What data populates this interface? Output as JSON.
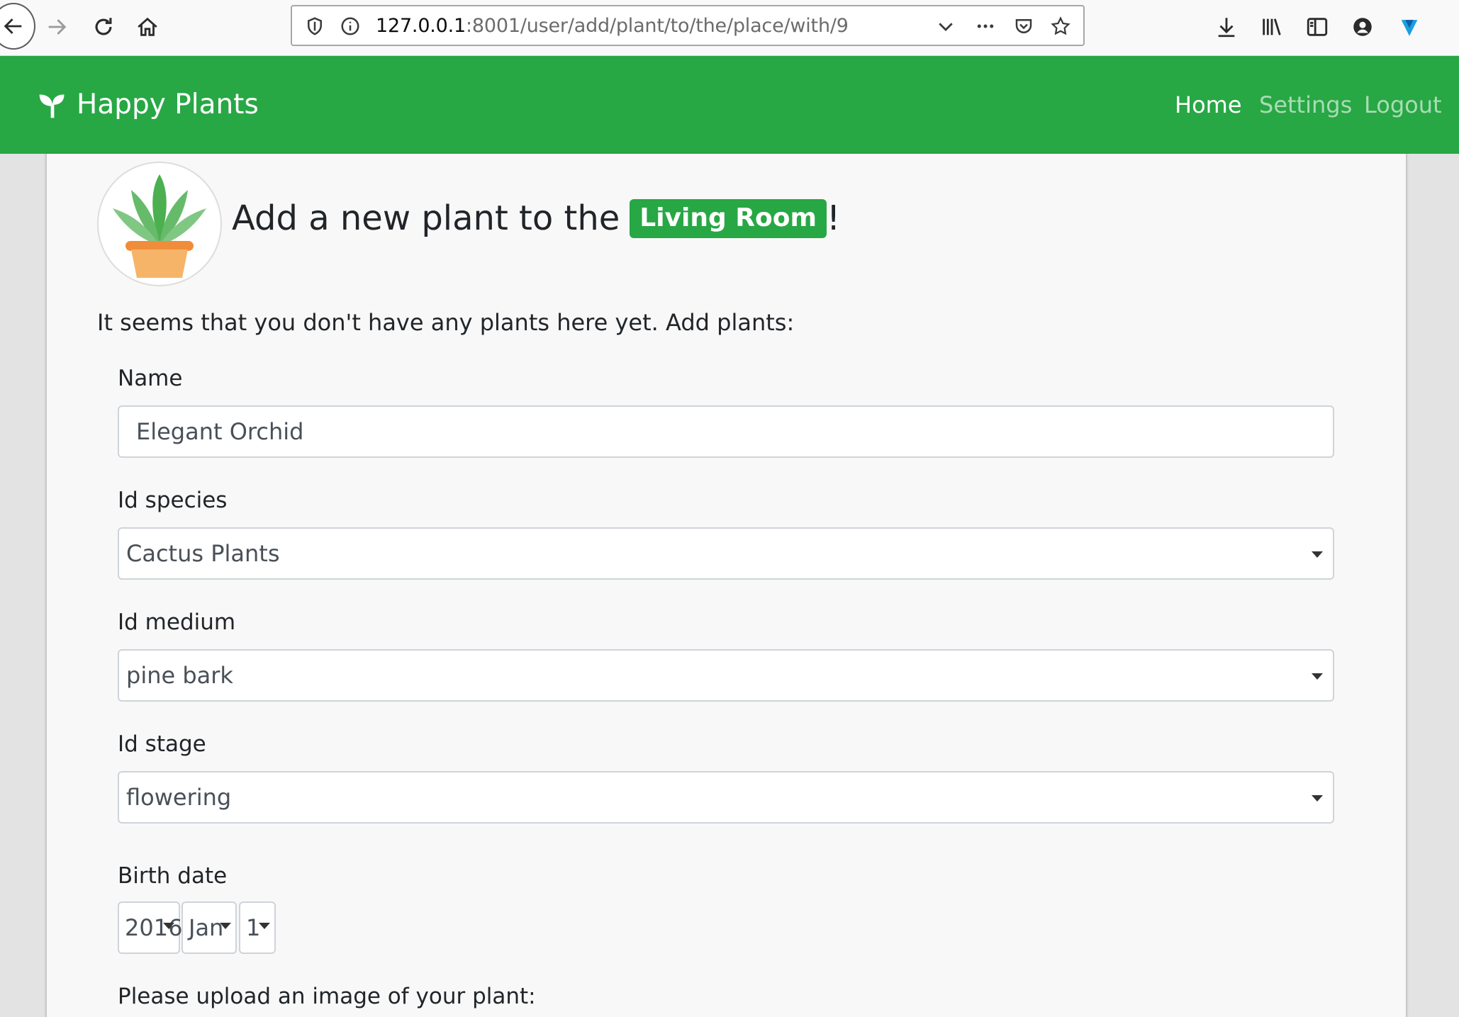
{
  "browser": {
    "url_host": "127.0.0.1",
    "url_path": ":8001/user/add/plant/to/the/place/with/9"
  },
  "navbar": {
    "brand": "Happy Plants",
    "links": [
      "Home",
      "Settings",
      "Logout"
    ],
    "active_link": "Home",
    "color": "#28a745"
  },
  "page": {
    "heading_prefix": "Add a new plant to the",
    "place_badge": "Living Room",
    "heading_suffix": "!",
    "intro": "It seems that you don't have any plants here yet. Add plants:"
  },
  "form": {
    "name_label": "Name",
    "name_value": "Elegant Orchid",
    "species_label": "Id species",
    "species_value": "Cactus Plants",
    "medium_label": "Id medium",
    "medium_value": "pine bark",
    "stage_label": "Id stage",
    "stage_value": "flowering",
    "birth_label": "Birth date",
    "birth_year": "2016",
    "birth_month": "Jan",
    "birth_day": "1",
    "upload_label": "Please upload an image of your plant:"
  }
}
